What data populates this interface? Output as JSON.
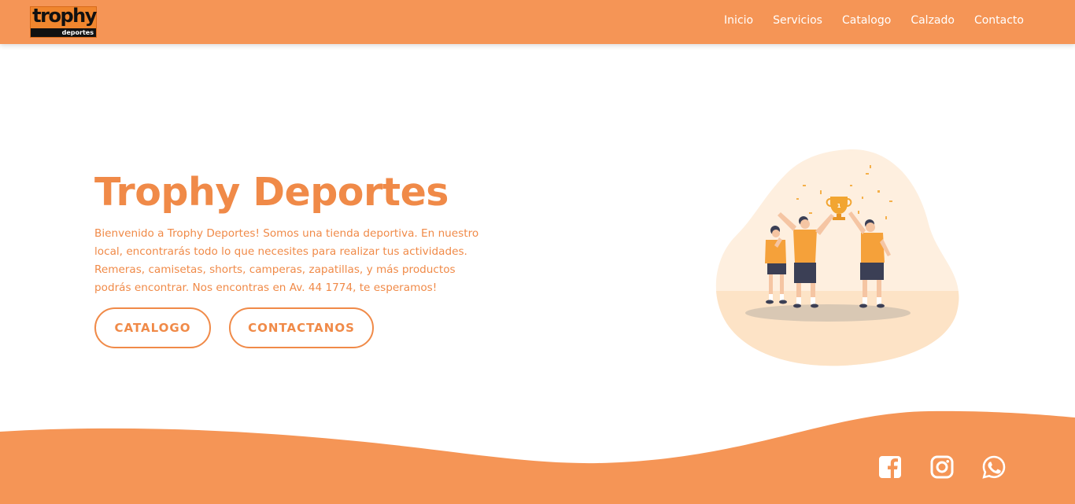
{
  "header": {
    "logo": {
      "main": "trophy",
      "sub": "deportes"
    },
    "nav": [
      "Inicio",
      "Servicios",
      "Catalogo",
      "Calzado",
      "Contacto"
    ]
  },
  "hero": {
    "title": "Trophy Deportes",
    "description": "Bienvenido a Trophy Deportes! Somos una tienda deportiva. En nuestro local, encontrarás todo lo que necesites para realizar tus actividades. Remeras, camisetas, shorts, camperas, zapatillas, y más productos podrás encontrar. Nos encontras en Av. 44 1774, te esperamos!",
    "buttons": {
      "catalogo": "CATALOGO",
      "contact": "CONTACTANOS"
    }
  },
  "illustration": {
    "trophy_label": "1"
  },
  "footer": {
    "social_icons": [
      "facebook-icon",
      "instagram-icon",
      "whatsapp-icon"
    ]
  },
  "colors": {
    "accent": "#F59556",
    "text_accent": "#F08A48",
    "blob": "#FEEBD6",
    "shirt": "#F5A13A",
    "shorts": "#3B3F55"
  }
}
